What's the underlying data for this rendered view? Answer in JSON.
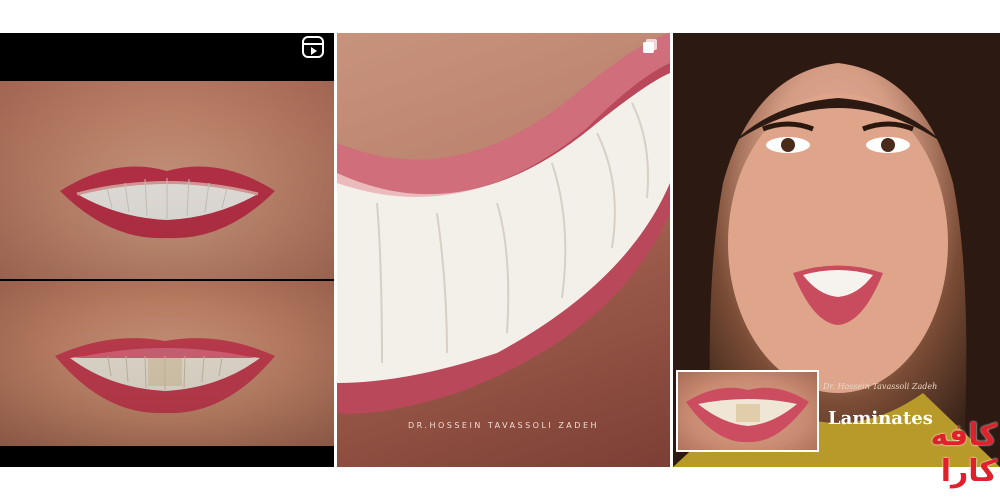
{
  "tiles": [
    {
      "type": "reel",
      "icon": "reels-icon",
      "content": "before-after-smile"
    },
    {
      "type": "carousel",
      "icon": "multiple-images-icon",
      "content": "closeup-smile",
      "signature": "DR.HOSSEIN TAVASSOLI ZADEH"
    },
    {
      "type": "post",
      "content": "portrait-smile",
      "signature": "Dr. Hossein Tavassoli Zadeh",
      "caption": "Laminates"
    }
  ],
  "watermark": {
    "line1": "کافه",
    "line2": "کارا",
    "color": "#e0202a"
  }
}
